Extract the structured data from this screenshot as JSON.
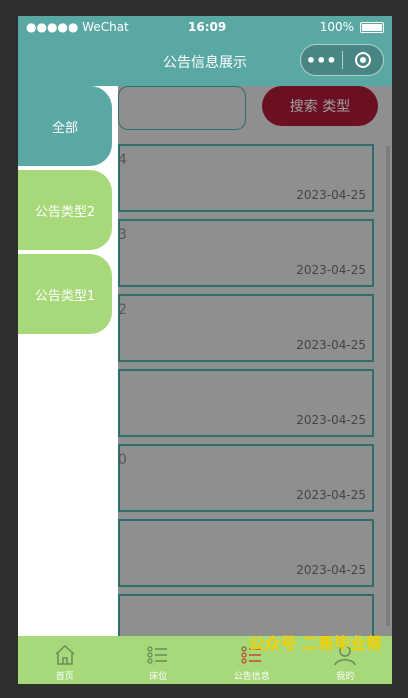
{
  "status_bar": {
    "carrier": "●●●●● WeChat",
    "time": "16:09",
    "battery": "100%"
  },
  "navbar": {
    "title": "公告信息展示",
    "menu_dots": "•••"
  },
  "search": {
    "button_label": "搜索  类型"
  },
  "drawer": {
    "items": [
      {
        "label": "全部",
        "active": true
      },
      {
        "label": "公告类型2",
        "active": false
      },
      {
        "label": "公告类型1",
        "active": false
      }
    ]
  },
  "cards": [
    {
      "num": "4",
      "date": "2023-04-25"
    },
    {
      "num": "3",
      "date": "2023-04-25"
    },
    {
      "num": "2",
      "date": "2023-04-25"
    },
    {
      "num": "",
      "date": "2023-04-25"
    },
    {
      "num": "0",
      "date": "2023-04-25"
    },
    {
      "num": "",
      "date": "2023-04-25"
    }
  ],
  "tabbar": {
    "tabs": [
      {
        "label": "首页",
        "icon": "home-icon"
      },
      {
        "label": "床位",
        "icon": "list-icon"
      },
      {
        "label": "公告信息",
        "icon": "list-icon"
      },
      {
        "label": "我的",
        "icon": "user-icon"
      }
    ]
  },
  "watermark": "公众号  二哥毕业帮",
  "colors": {
    "accent": "#5aa8a4",
    "secondary": "#a7d97a",
    "search_button": "#6b1022",
    "watermark": "#f5d000"
  }
}
